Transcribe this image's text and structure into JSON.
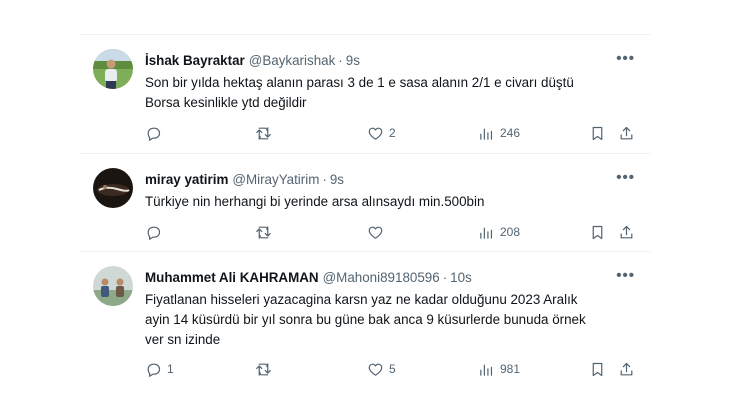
{
  "tweets": [
    {
      "name": "İshak Bayraktar",
      "handle": "@Baykarishak",
      "time": "9s",
      "more": "•••",
      "lines": [
        "Son bir yılda hektaş alanın parası 3 de 1 e sasa alanın 2/1 e civarı düştü",
        "Borsa kesinlikle ytd değildir"
      ],
      "replies": "",
      "retweets": "",
      "likes": "2",
      "views": "246"
    },
    {
      "name": "miray yatirim",
      "handle": "@MirayYatirim",
      "time": "9s",
      "more": "•••",
      "lines": [
        "Türkiye nin herhangi bi yerinde arsa alınsaydı min.500bin"
      ],
      "replies": "",
      "retweets": "",
      "likes": "",
      "views": "208"
    },
    {
      "name": "Muhammet Ali KAHRAMAN",
      "handle": "@Mahoni89180596",
      "time": "10s",
      "more": "•••",
      "lines": [
        "Fiyatlanan hisseleri yazacagina karsn yaz ne kadar olduğunu 2023 Aralık",
        "ayin 14 küsürdü bir yıl sonra bu güne bak anca 9 küsurlerde bunuda örnek",
        "ver sn izinde"
      ],
      "replies": "1",
      "retweets": "",
      "likes": "5",
      "views": "981"
    }
  ],
  "colors": {
    "text": "#0f1419",
    "secondary": "#536471",
    "divider": "#eff3f4"
  },
  "icons": [
    "reply-icon",
    "retweet-icon",
    "like-icon",
    "views-icon",
    "bookmark-icon",
    "share-icon",
    "more-icon"
  ]
}
